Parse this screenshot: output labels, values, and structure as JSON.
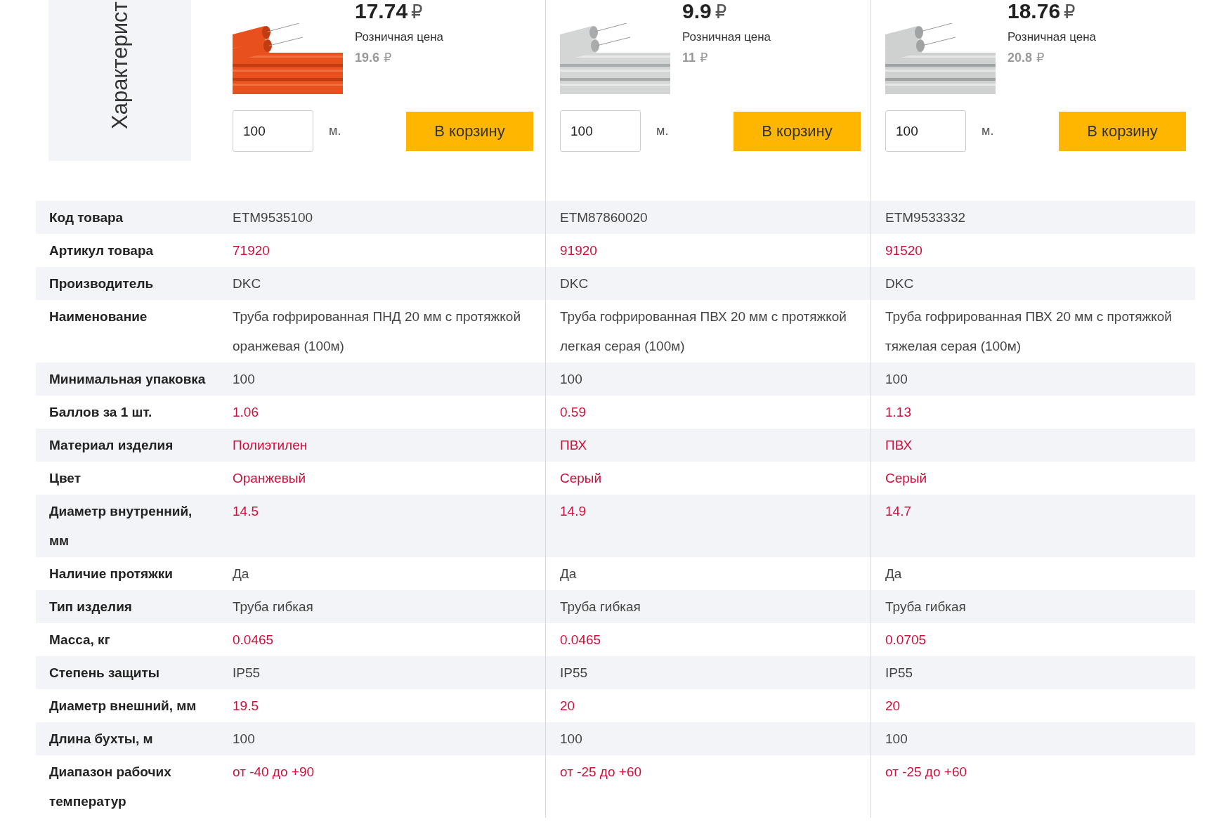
{
  "side_label": "Характерист",
  "products": [
    {
      "price": "17.74",
      "currency": "₽",
      "retail_label": "Розничная цена",
      "retail_price": "19.6",
      "retail_currency": "₽",
      "quantity": "100",
      "unit": "м.",
      "cart_button": "В корзину"
    },
    {
      "price": "9.9",
      "currency": "₽",
      "retail_label": "Розничная цена",
      "retail_price": "11",
      "retail_currency": "₽",
      "quantity": "100",
      "unit": "м.",
      "cart_button": "В корзину"
    },
    {
      "price": "18.76",
      "currency": "₽",
      "retail_label": "Розничная цена",
      "retail_price": "20.8",
      "retail_currency": "₽",
      "quantity": "100",
      "unit": "м.",
      "cart_button": "В корзину"
    }
  ],
  "rows": [
    {
      "label": "Код товара",
      "values": [
        {
          "text": "ETM9535100",
          "kind": "text"
        },
        {
          "text": "ETM87860020",
          "kind": "text"
        },
        {
          "text": "ETM9533332",
          "kind": "text"
        }
      ]
    },
    {
      "label": "Артикул товара",
      "values": [
        {
          "text": "71920",
          "kind": "link"
        },
        {
          "text": "91920",
          "kind": "link"
        },
        {
          "text": "91520",
          "kind": "link"
        }
      ]
    },
    {
      "label": "Производитель",
      "values": [
        {
          "text": "DKC",
          "kind": "text"
        },
        {
          "text": "DKC",
          "kind": "text"
        },
        {
          "text": "DKC",
          "kind": "text"
        }
      ]
    },
    {
      "label": "Наименование",
      "values": [
        {
          "text": "Труба гофрированная ПНД 20 мм с протяжкой оранжевая (100м)",
          "kind": "text"
        },
        {
          "text": "Труба гофрированная ПВХ 20 мм с протяжкой легкая серая (100м)",
          "kind": "text"
        },
        {
          "text": "Труба гофрированная ПВХ 20 мм с протяжкой тяжелая серая (100м)",
          "kind": "text"
        }
      ]
    },
    {
      "label": "Минимальная упаковка",
      "values": [
        {
          "text": "100",
          "kind": "text"
        },
        {
          "text": "100",
          "kind": "text"
        },
        {
          "text": "100",
          "kind": "text"
        }
      ]
    },
    {
      "label": "Баллов за 1 шт.",
      "values": [
        {
          "text": "1.06",
          "kind": "link"
        },
        {
          "text": "0.59",
          "kind": "link"
        },
        {
          "text": "1.13",
          "kind": "link"
        }
      ]
    },
    {
      "label": "Материал изделия",
      "values": [
        {
          "text": "Полиэтилен",
          "kind": "link"
        },
        {
          "text": "ПВХ",
          "kind": "link"
        },
        {
          "text": "ПВХ",
          "kind": "link"
        }
      ]
    },
    {
      "label": "Цвет",
      "values": [
        {
          "text": "Оранжевый",
          "kind": "link"
        },
        {
          "text": "Серый",
          "kind": "link"
        },
        {
          "text": "Серый",
          "kind": "link"
        }
      ]
    },
    {
      "label": "Диаметр внутренний, мм",
      "values": [
        {
          "text": "14.5",
          "kind": "link"
        },
        {
          "text": "14.9",
          "kind": "link"
        },
        {
          "text": "14.7",
          "kind": "link"
        }
      ]
    },
    {
      "label": "Наличие протяжки",
      "values": [
        {
          "text": "Да",
          "kind": "text"
        },
        {
          "text": "Да",
          "kind": "text"
        },
        {
          "text": "Да",
          "kind": "text"
        }
      ]
    },
    {
      "label": "Тип изделия",
      "values": [
        {
          "text": "Труба гибкая",
          "kind": "text"
        },
        {
          "text": "Труба гибкая",
          "kind": "text"
        },
        {
          "text": "Труба гибкая",
          "kind": "text"
        }
      ]
    },
    {
      "label": "Масса, кг",
      "values": [
        {
          "text": "0.0465",
          "kind": "link"
        },
        {
          "text": "0.0465",
          "kind": "link"
        },
        {
          "text": "0.0705",
          "kind": "link"
        }
      ]
    },
    {
      "label": "Степень защиты",
      "values": [
        {
          "text": "IP55",
          "kind": "text"
        },
        {
          "text": "IP55",
          "kind": "text"
        },
        {
          "text": "IP55",
          "kind": "text"
        }
      ]
    },
    {
      "label": "Диаметр внешний, мм",
      "values": [
        {
          "text": "19.5",
          "kind": "link"
        },
        {
          "text": "20",
          "kind": "link"
        },
        {
          "text": "20",
          "kind": "link"
        }
      ]
    },
    {
      "label": "Длина бухты, м",
      "values": [
        {
          "text": "100",
          "kind": "text"
        },
        {
          "text": "100",
          "kind": "text"
        },
        {
          "text": "100",
          "kind": "text"
        }
      ]
    },
    {
      "label": "Диапазон рабочих температур",
      "values": [
        {
          "text": "от -40 до +90",
          "kind": "link"
        },
        {
          "text": "от -25 до +60",
          "kind": "link"
        },
        {
          "text": "от -25 до +60",
          "kind": "link"
        }
      ]
    }
  ]
}
